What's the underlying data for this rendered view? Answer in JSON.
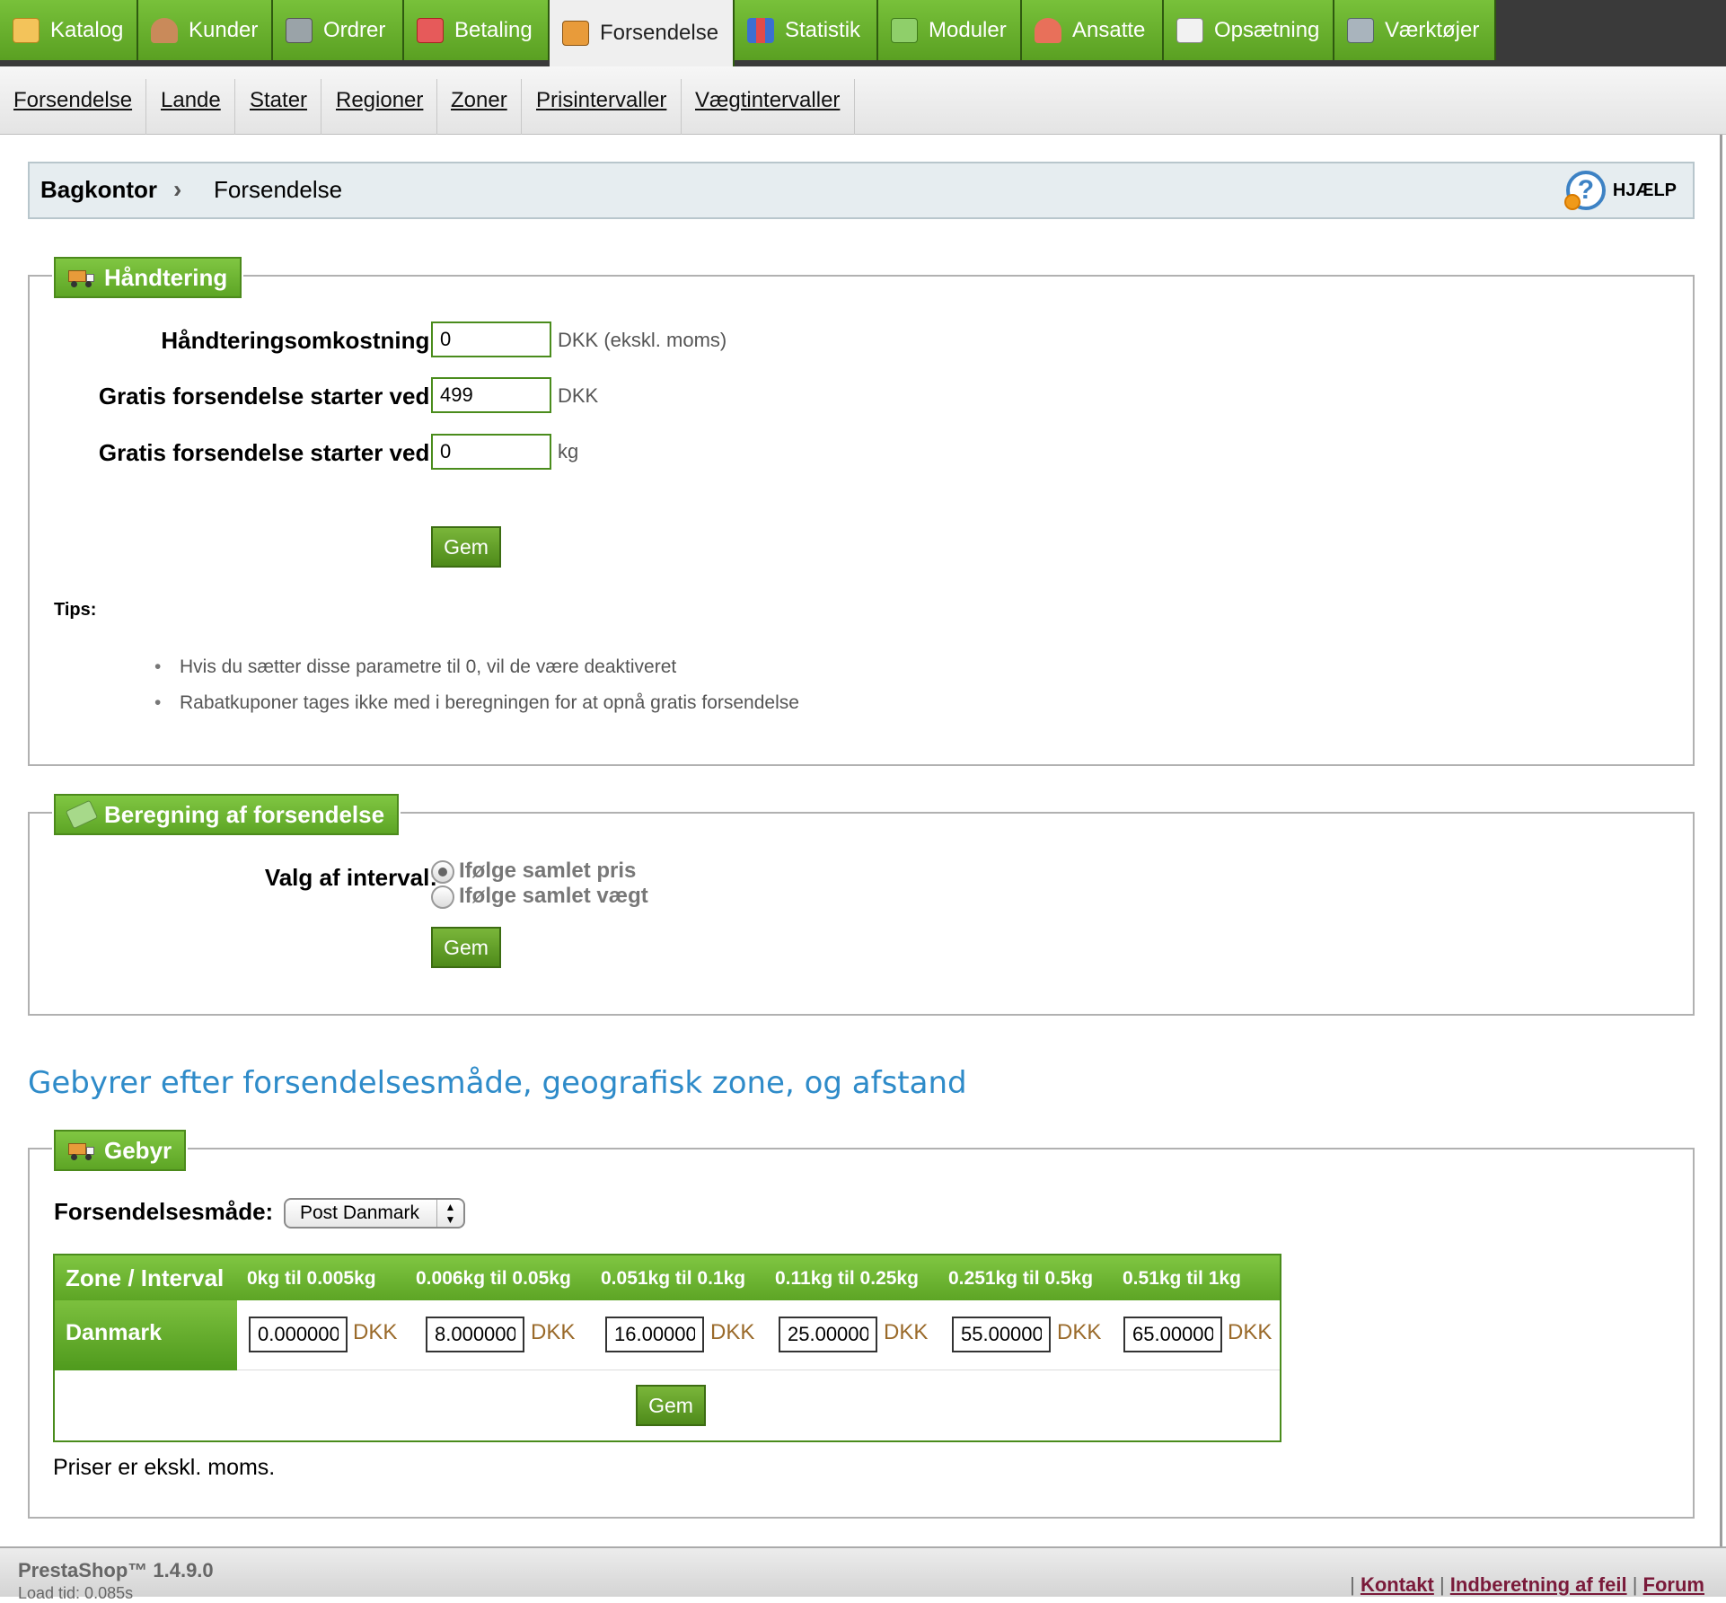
{
  "top_menu": {
    "tabs": [
      {
        "label": "Katalog",
        "icon": "folder-icon"
      },
      {
        "label": "Kunder",
        "icon": "customer-icon"
      },
      {
        "label": "Ordrer",
        "icon": "cart-icon"
      },
      {
        "label": "Betaling",
        "icon": "payment-icon"
      },
      {
        "label": "Forsendelse",
        "icon": "truck-icon"
      },
      {
        "label": "Statistik",
        "icon": "bar-chart-icon"
      },
      {
        "label": "Moduler",
        "icon": "puzzle-icon"
      },
      {
        "label": "Ansatte",
        "icon": "employee-icon"
      },
      {
        "label": "Opsætning",
        "icon": "settings-icon"
      },
      {
        "label": "Værktøjer",
        "icon": "wrench-icon"
      }
    ],
    "active": "Forsendelse"
  },
  "sub_menu": {
    "items": [
      "Forsendelse",
      "Lande",
      "Stater",
      "Regioner",
      "Zoner",
      "Prisintervaller",
      "Vægtintervaller"
    ]
  },
  "breadcrumb": {
    "root": "Bagkontor",
    "separator": "›",
    "current": "Forsendelse",
    "help_label": "HJÆLP"
  },
  "handling": {
    "legend": "Håndtering",
    "fields": [
      {
        "label": "Håndteringsomkostning:",
        "value": "0",
        "unit": "DKK (ekskl. moms)"
      },
      {
        "label": "Gratis forsendelse starter ved:",
        "value": "499",
        "unit": "DKK"
      },
      {
        "label": "Gratis forsendelse starter ved:",
        "value": "0",
        "unit": "kg"
      }
    ],
    "save_label": "Gem",
    "tips_title": "Tips:",
    "tips": [
      "Hvis du sætter disse parametre til 0, vil de være deaktiveret",
      "Rabatkuponer tages ikke med i beregningen for at opnå gratis forsendelse"
    ]
  },
  "calculation": {
    "legend": "Beregning af forsendelse",
    "label": "Valg af interval:",
    "options": [
      {
        "label": "Ifølge samlet pris",
        "selected": true
      },
      {
        "label": "Ifølge samlet vægt",
        "selected": false
      }
    ],
    "save_label": "Gem"
  },
  "fees": {
    "section_title": "Gebyrer efter forsendelsesmåde, geografisk zone, og afstand",
    "legend": "Gebyr",
    "carrier_label": "Forsendelsesmåde:",
    "carrier_value": "Post Danmark",
    "table": {
      "corner": "Zone / Interval",
      "columns": [
        "0kg til 0.005kg",
        "0.006kg til 0.05kg",
        "0.051kg til 0.1kg",
        "0.11kg til 0.25kg",
        "0.251kg til 0.5kg",
        "0.51kg til 1kg"
      ],
      "rows": [
        {
          "zone": "Danmark",
          "values": [
            "0.000000",
            "8.000000",
            "16.000000",
            "25.000000",
            "55.000000",
            "65.000000"
          ],
          "currency": "DKK"
        }
      ]
    },
    "save_label": "Gem",
    "note": "Priser er ekskl. moms."
  },
  "footer": {
    "version": "PrestaShop™ 1.4.9.0",
    "load_time": "Load tid: 0.085s",
    "links": [
      "Kontakt",
      "Indberetning af feil",
      "Forum"
    ]
  },
  "colors": {
    "accent_green": "#5da525",
    "title_blue": "#2e8bc9",
    "currency_brown": "#9a6a2a"
  }
}
